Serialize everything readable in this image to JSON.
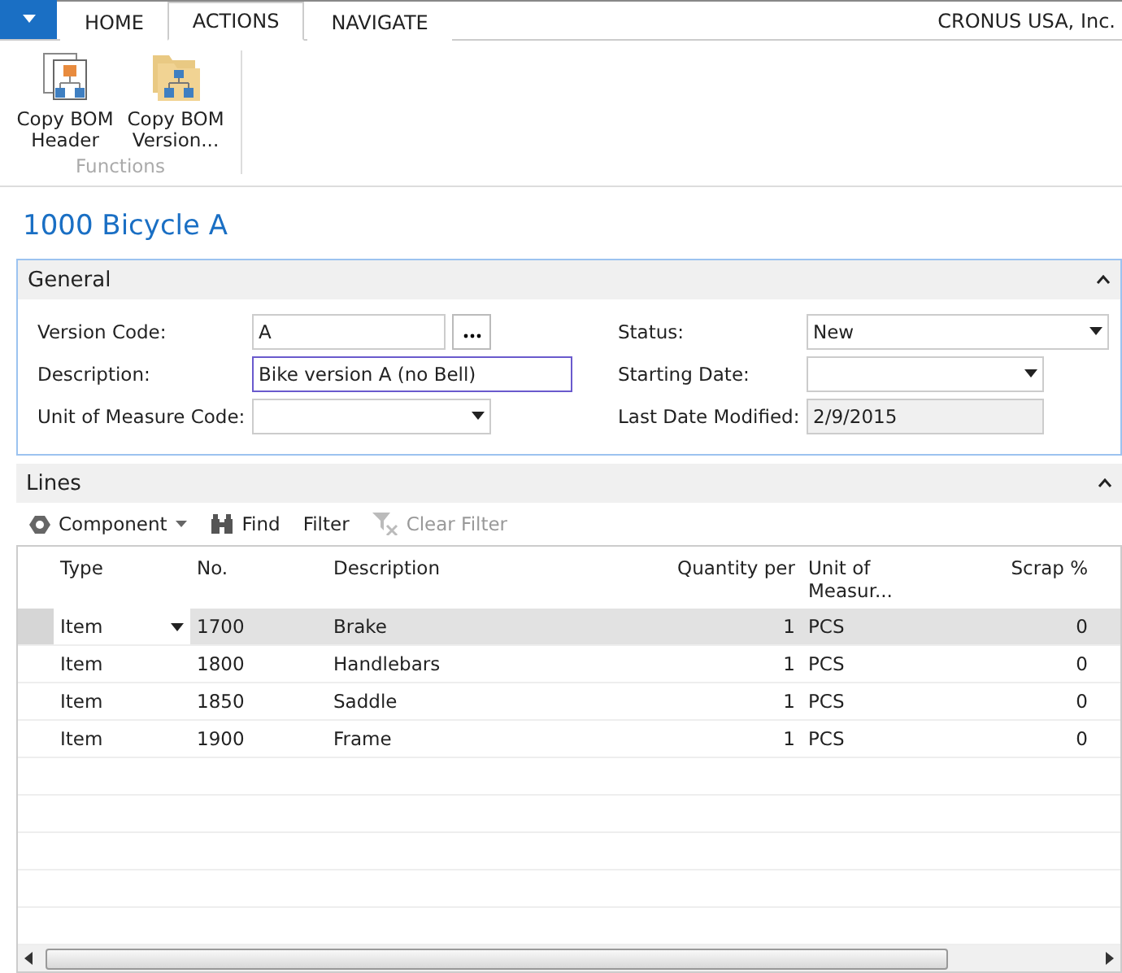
{
  "tabs": [
    {
      "label": "HOME",
      "selected": false
    },
    {
      "label": "ACTIONS",
      "selected": true
    },
    {
      "label": "NAVIGATE",
      "selected": false
    }
  ],
  "company": "CRONUS USA, Inc.",
  "ribbon": {
    "actions": [
      {
        "label": "Copy BOM Header",
        "kind": "header"
      },
      {
        "label": "Copy BOM Version...",
        "kind": "version"
      }
    ],
    "group": "Functions"
  },
  "title": "1000 Bicycle A",
  "general": {
    "title": "General",
    "expanded": true,
    "left": [
      {
        "label": "Version Code:",
        "value": "A",
        "kind": "lookup"
      },
      {
        "label": "Description:",
        "value": "Bike version A (no Bell)",
        "kind": "text"
      },
      {
        "label": "Unit of Measure Code:",
        "kind": "dropdown"
      }
    ],
    "right": [
      {
        "label": "Status:",
        "value": "New",
        "kind": "dropdown"
      },
      {
        "label": "Starting Date:",
        "kind": "dropdown"
      },
      {
        "label": "Last Date Modified:",
        "value": "2/9/2015",
        "kind": "readonly"
      }
    ]
  },
  "lines": {
    "title": "Lines",
    "expanded": true,
    "toolbar": [
      {
        "label": "Component",
        "kind": "component",
        "disabled": false
      },
      {
        "label": "Find",
        "kind": "find",
        "disabled": false
      },
      {
        "label": "Filter",
        "kind": "plain",
        "disabled": false
      },
      {
        "label": "Clear Filter",
        "kind": "clear",
        "disabled": true
      }
    ],
    "columns": [
      "Type",
      "No.",
      "Description",
      "Quantity per",
      "Unit of Measur...",
      "Scrap %"
    ],
    "rows": [
      {
        "cells": [
          "Item",
          "1700",
          "Brake",
          "1",
          "PCS",
          "0"
        ],
        "selected": true
      },
      {
        "cells": [
          "Item",
          "1800",
          "Handlebars",
          "1",
          "PCS",
          "0"
        ],
        "selected": false
      },
      {
        "cells": [
          "Item",
          "1850",
          "Saddle",
          "1",
          "PCS",
          "0"
        ],
        "selected": false
      },
      {
        "cells": [
          "Item",
          "1900",
          "Frame",
          "1",
          "PCS",
          "0"
        ],
        "selected": false
      }
    ]
  }
}
